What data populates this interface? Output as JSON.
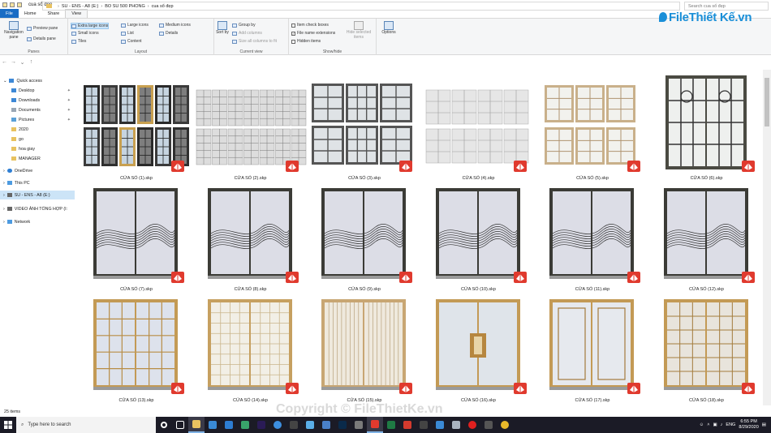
{
  "window": {
    "title": "cua sổ đẹp"
  },
  "tabs": [
    {
      "label": "File"
    },
    {
      "label": "Home"
    },
    {
      "label": "Share"
    },
    {
      "label": "View"
    }
  ],
  "ribbon": {
    "panes": {
      "navigation_pane": "Navigation pane",
      "preview_pane": "Preview pane",
      "details_pane": "Details pane",
      "group_label": "Panes"
    },
    "layout": {
      "extra_large_icons": "Extra large icons",
      "large_icons": "Large icons",
      "medium_icons": "Medium icons",
      "small_icons": "Small icons",
      "list": "List",
      "details": "Details",
      "tiles": "Tiles",
      "content": "Content",
      "group_label": "Layout"
    },
    "current_view": {
      "sort_by": "Sort by",
      "group_by": "Group by",
      "add_columns": "Add columns",
      "size_all_columns": "Size all columns to fit",
      "group_label": "Current view"
    },
    "show_hide": {
      "item_check_boxes": "Item check boxes",
      "file_name_extensions": "File name extensions",
      "hidden_items": "Hidden items",
      "hide_selected_items": "Hide selected items",
      "group_label": "Show/hide"
    },
    "options": {
      "options": "Options"
    }
  },
  "address": {
    "crumbs": [
      "SU - ENS - A8 (E:)",
      "BO SU 500 PHONG",
      "cua sổ đẹp"
    ],
    "search_placeholder": "Search cua sổ đẹp"
  },
  "sidebar": {
    "items": [
      {
        "label": "Quick access"
      },
      {
        "label": "Desktop"
      },
      {
        "label": "Downloads"
      },
      {
        "label": "Documents"
      },
      {
        "label": "Pictures"
      },
      {
        "label": "2020"
      },
      {
        "label": "go"
      },
      {
        "label": "hoa giay"
      },
      {
        "label": "MANAGER"
      },
      {
        "label": "OneDrive"
      },
      {
        "label": "This PC"
      },
      {
        "label": "SU - ENS - A8 (E:)"
      },
      {
        "label": "VIDEO ẢNH TỔNG HỢP (I:"
      },
      {
        "label": "Network"
      }
    ]
  },
  "files": [
    {
      "name": "CỬA SỔ (1).skp"
    },
    {
      "name": "CỬA SỔ (2).skp"
    },
    {
      "name": "CỬA SỔ (3).skp"
    },
    {
      "name": "CỬA SỔ (4).skp"
    },
    {
      "name": "CỬA SỔ (5).skp"
    },
    {
      "name": "CỬA SỔ (6).skp"
    },
    {
      "name": "CỬA SỔ (7).skp"
    },
    {
      "name": "CỬA SỔ (8).skp"
    },
    {
      "name": "CỬA SỔ (9).skp"
    },
    {
      "name": "CỬA SỔ (10).skp"
    },
    {
      "name": "CỬA SỔ (11).skp"
    },
    {
      "name": "CỬA SỔ (12).skp"
    },
    {
      "name": "CỬA SỔ (13).skp"
    },
    {
      "name": "CỬA SỔ (14).skp"
    },
    {
      "name": "CỬA SỔ (15).skp"
    },
    {
      "name": "CỬA SỔ (16).skp"
    },
    {
      "name": "CỬA SỔ (17).skp"
    },
    {
      "name": "CỬA SỔ (18).skp"
    }
  ],
  "status": {
    "item_count": "25 items"
  },
  "taskbar": {
    "search_placeholder": "Type here to search",
    "language": "ENG",
    "time": "6:55 PM",
    "date": "8/29/2020"
  },
  "branding": {
    "logo_text": "FileThiết Kế.vn",
    "watermark": "Copyright © FileThietKe.vn"
  },
  "colors": {
    "accent": "#1a6cc4",
    "selection": "#cce4f7",
    "taskbar": "#1b1b26",
    "sketchup_red": "#e03a2e"
  }
}
